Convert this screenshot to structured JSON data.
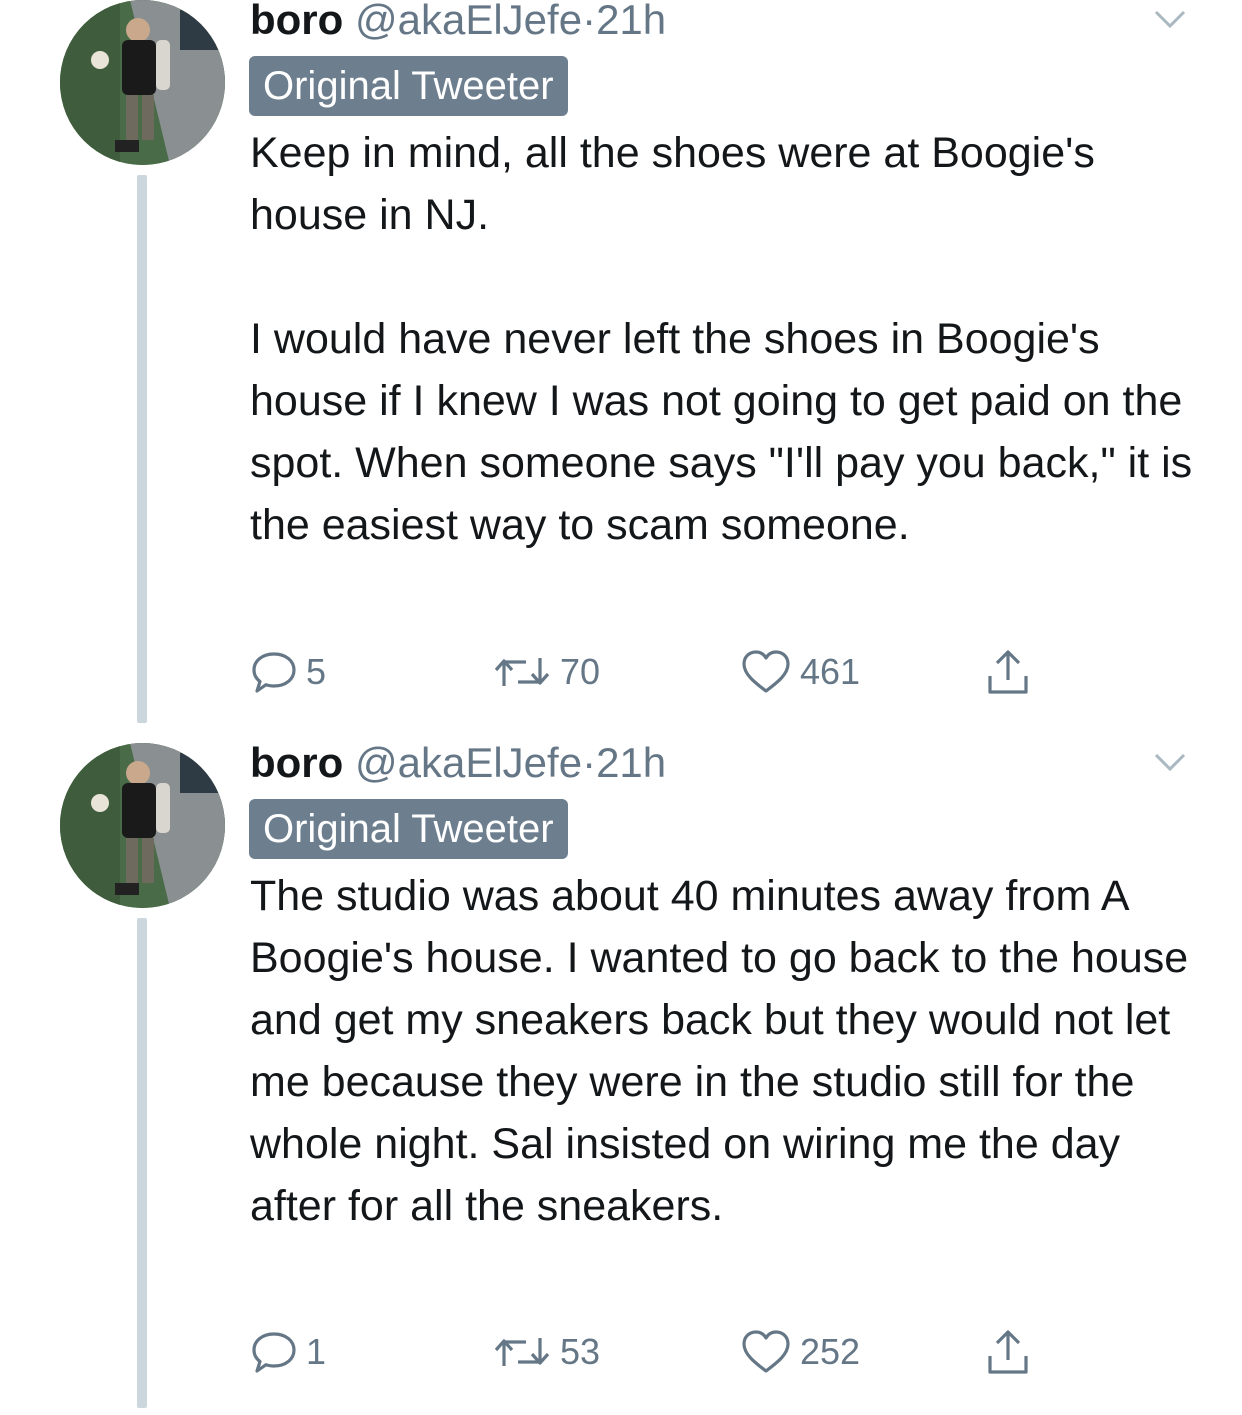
{
  "tweets": [
    {
      "name": "boro",
      "handle": "@akaElJefe",
      "separator": "·",
      "time": "21h",
      "badge": "Original Tweeter",
      "paragraphs": [
        "Keep in mind, all the shoes were at Boogie's house in NJ.",
        "I would have never left the shoes in Boogie's house if I knew I was not going to get paid on the spot. When someone says \"I'll pay you back,\" it is the easiest way to scam someone."
      ],
      "replies": "5",
      "retweets": "70",
      "likes": "461"
    },
    {
      "name": "boro",
      "handle": "@akaElJefe",
      "separator": "·",
      "time": "21h",
      "badge": "Original Tweeter",
      "paragraphs": [
        "The studio was about 40 minutes away from A Boogie's house. I wanted to go back to the house and get my sneakers back but they would not let me because they were in the studio still for the whole night. Sal insisted on wiring me the day after for all the sneakers."
      ],
      "replies": "1",
      "retweets": "53",
      "likes": "252"
    }
  ],
  "icons": {
    "reply": "reply-icon",
    "retweet": "retweet-icon",
    "like": "heart-icon",
    "share": "share-icon",
    "menu": "chevron-down-icon"
  },
  "colors": {
    "text": "#14171a",
    "secondary": "#657786",
    "badge": "#6d7f8f",
    "thread": "#ccd6dd"
  }
}
